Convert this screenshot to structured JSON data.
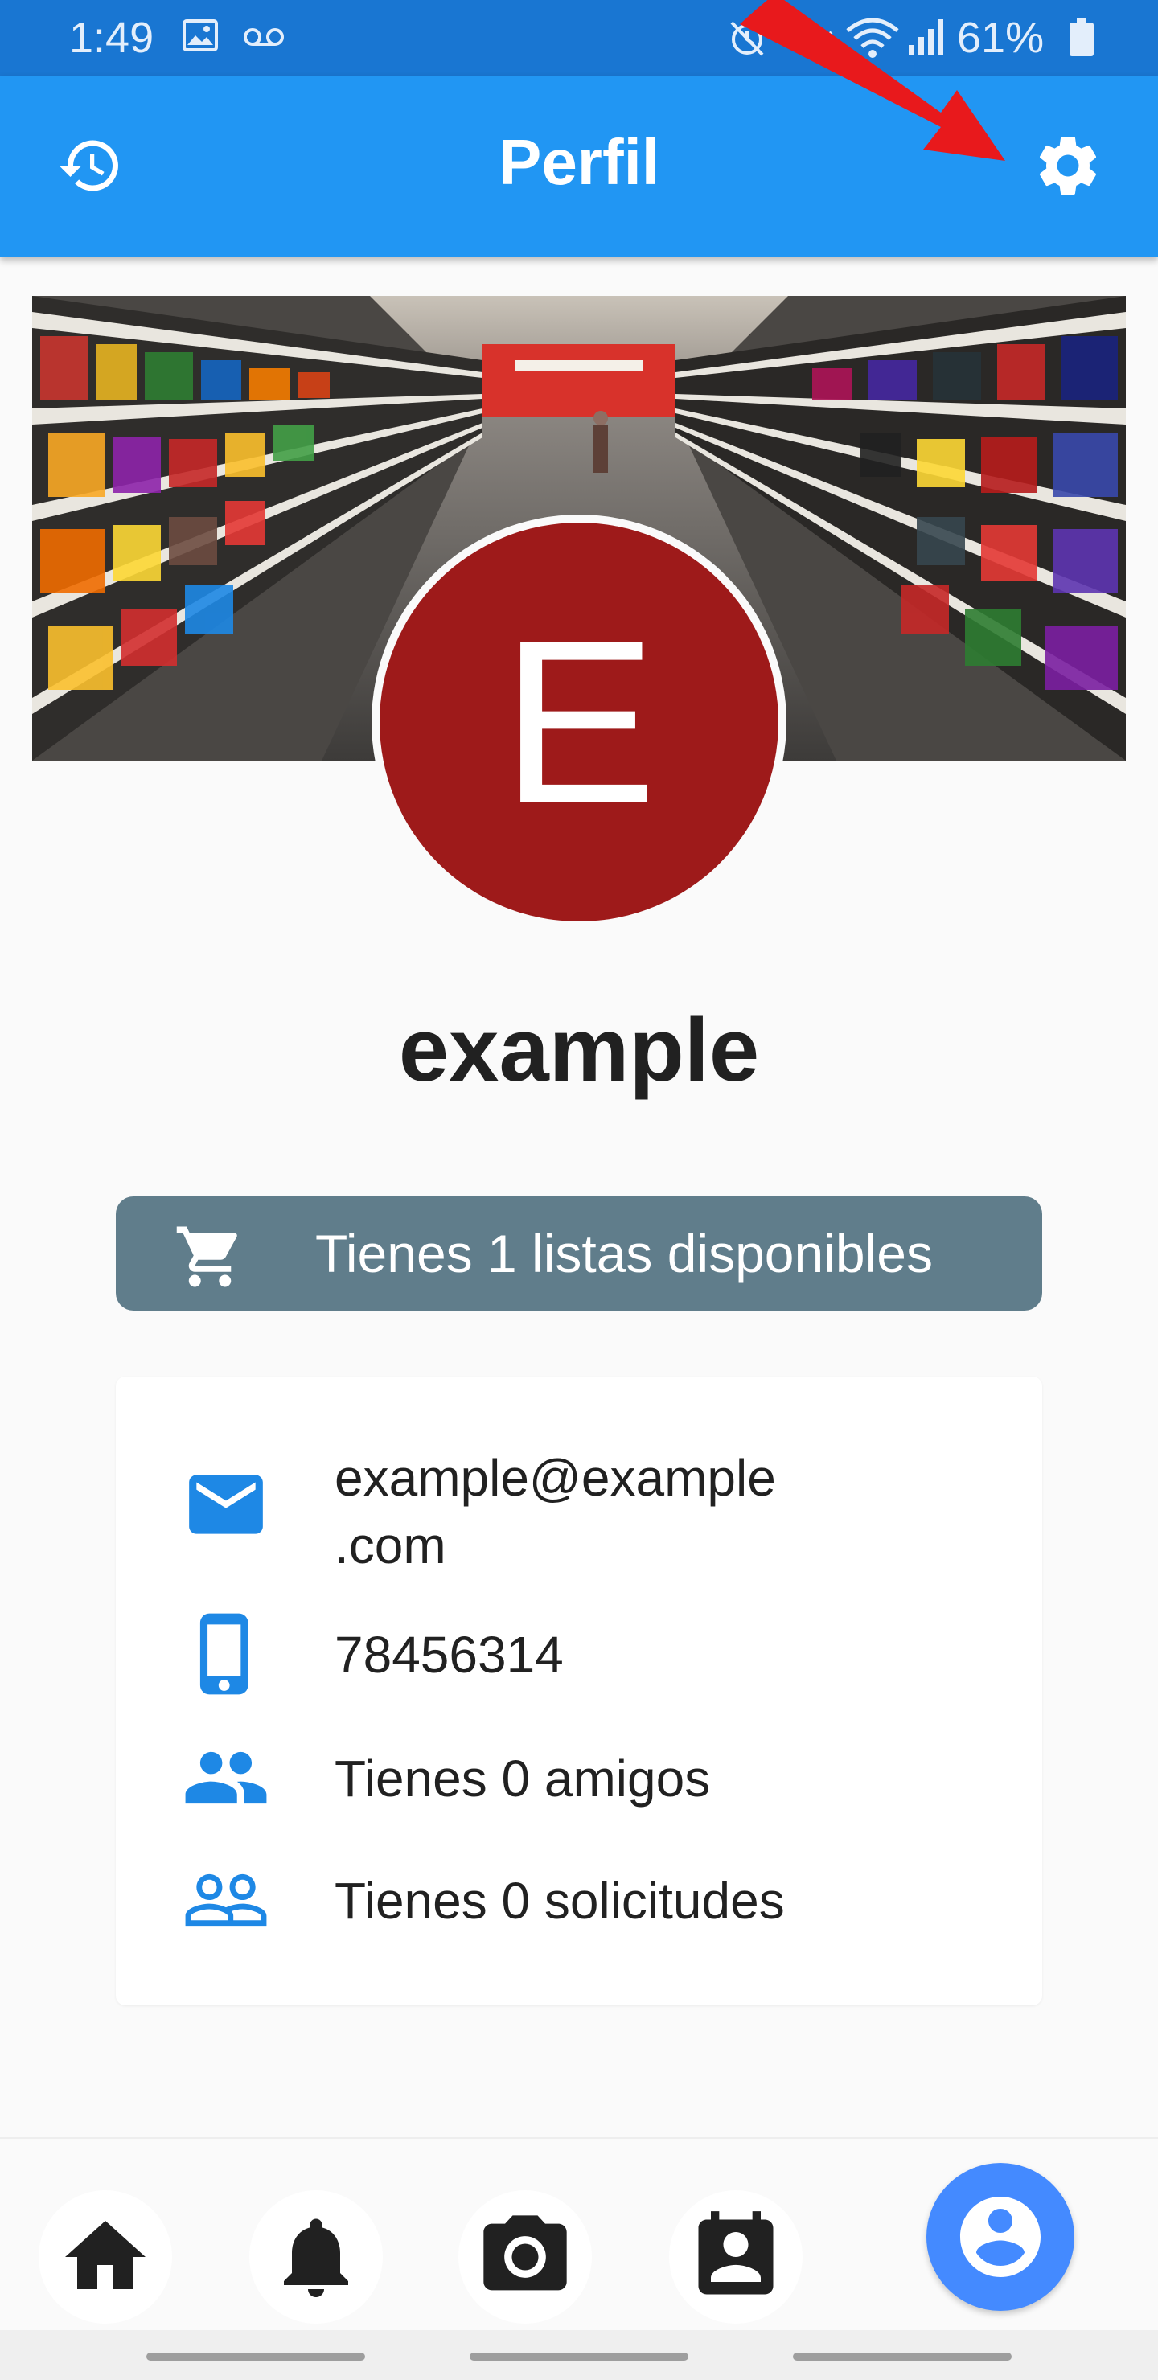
{
  "status_bar": {
    "time": "1:49",
    "battery": "61%",
    "icons": [
      "gallery-icon",
      "voicemail-icon",
      "alarm-icon",
      "mute-icon",
      "wifi-icon",
      "signal-icon",
      "battery-icon"
    ]
  },
  "app_bar": {
    "title": "Perfil",
    "left_icon": "history-icon",
    "right_icon": "settings-gear-icon"
  },
  "profile": {
    "avatar_initial": "E",
    "name": "example",
    "banner": "supermarket aisle photo"
  },
  "lists_button": {
    "icon": "cart-icon",
    "label": "Tienes 1 listas disponibles"
  },
  "info": {
    "email": "example@example\n.com",
    "phone": "78456314",
    "friends": "Tienes 0 amigos",
    "requests": "Tienes 0 solicitudes"
  },
  "bottom_nav": {
    "items": [
      "home-icon",
      "bell-icon",
      "camera-icon",
      "contacts-icon",
      "profile-icon"
    ],
    "active": "profile-icon"
  },
  "colors": {
    "status_bar": "#1976d2",
    "app_bar": "#2196f3",
    "avatar": "#9e1a1a",
    "lists_button": "#607d8b",
    "info_icons": "#1e88e5",
    "nav_active": "#448aff",
    "annotation_arrow": "#e8191c"
  }
}
